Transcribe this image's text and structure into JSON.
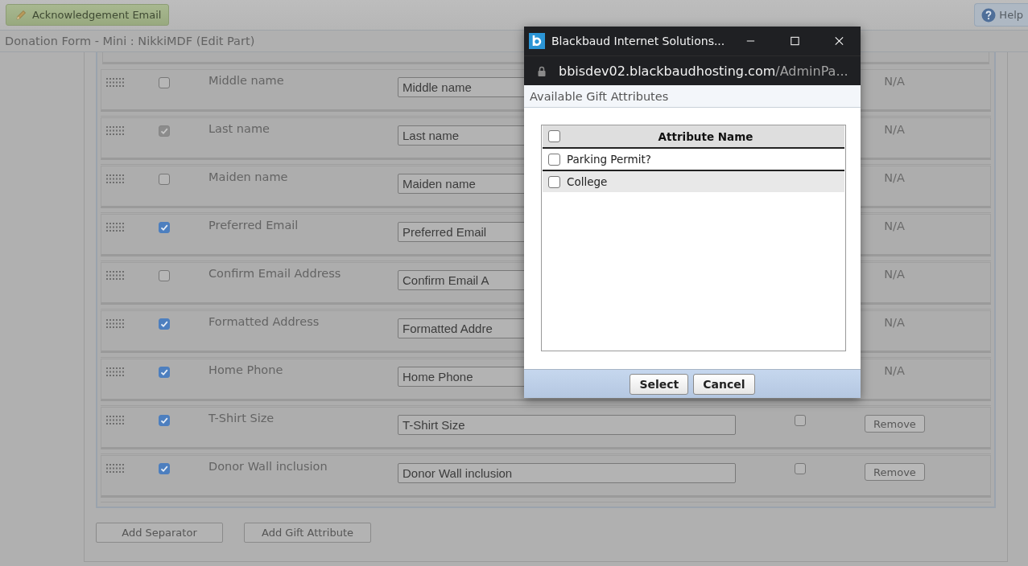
{
  "toolbar": {
    "email_button": "Acknowledgement Email",
    "help_button": "Help"
  },
  "page_title": "Donation Form - Mini : NikkiMDF (Edit Part)",
  "fields": [
    {
      "kind": "standard",
      "label": "Middle name",
      "included": false,
      "disabled": false,
      "value": "Middle name",
      "note": "N/A"
    },
    {
      "kind": "standard",
      "label": "Last name",
      "included": true,
      "disabled": true,
      "value": "Last name",
      "note": "N/A"
    },
    {
      "kind": "standard",
      "label": "Maiden name",
      "included": false,
      "disabled": false,
      "value": "Maiden name",
      "note": "N/A"
    },
    {
      "kind": "standard",
      "label": "Preferred Email",
      "included": true,
      "disabled": false,
      "value": "Preferred Email",
      "note": "N/A"
    },
    {
      "kind": "standard",
      "label": "Confirm Email Address",
      "included": false,
      "disabled": false,
      "value": "Confirm Email A",
      "note": "N/A"
    },
    {
      "kind": "standard",
      "label": "Formatted Address",
      "included": true,
      "disabled": false,
      "value": "Formatted Addre",
      "note": "N/A"
    },
    {
      "kind": "standard",
      "label": "Home Phone",
      "included": true,
      "disabled": false,
      "value": "Home Phone",
      "note": "N/A"
    },
    {
      "kind": "attribute",
      "label": "T-Shirt Size",
      "included": true,
      "disabled": false,
      "value": "T-Shirt Size",
      "required": false,
      "action": "Remove"
    },
    {
      "kind": "attribute",
      "label": "Donor Wall inclusion",
      "included": true,
      "disabled": false,
      "value": "Donor Wall inclusion",
      "required": false,
      "action": "Remove"
    }
  ],
  "buttons": [
    "Add Separator",
    "Add Gift Attribute"
  ],
  "dialog": {
    "title": "Blackbaud Internet Solutions...",
    "url_host": "bbisdev02.blackbaudhosting.com",
    "url_path": "/AdminPa...",
    "heading": "Available Gift Attributes",
    "table": {
      "column": "Attribute Name",
      "all_checked": false,
      "rows": [
        {
          "name": "Parking Permit?",
          "checked": false,
          "selected": false
        },
        {
          "name": "College",
          "checked": false,
          "selected": true
        }
      ]
    },
    "buttons": [
      "Select",
      "Cancel"
    ]
  }
}
